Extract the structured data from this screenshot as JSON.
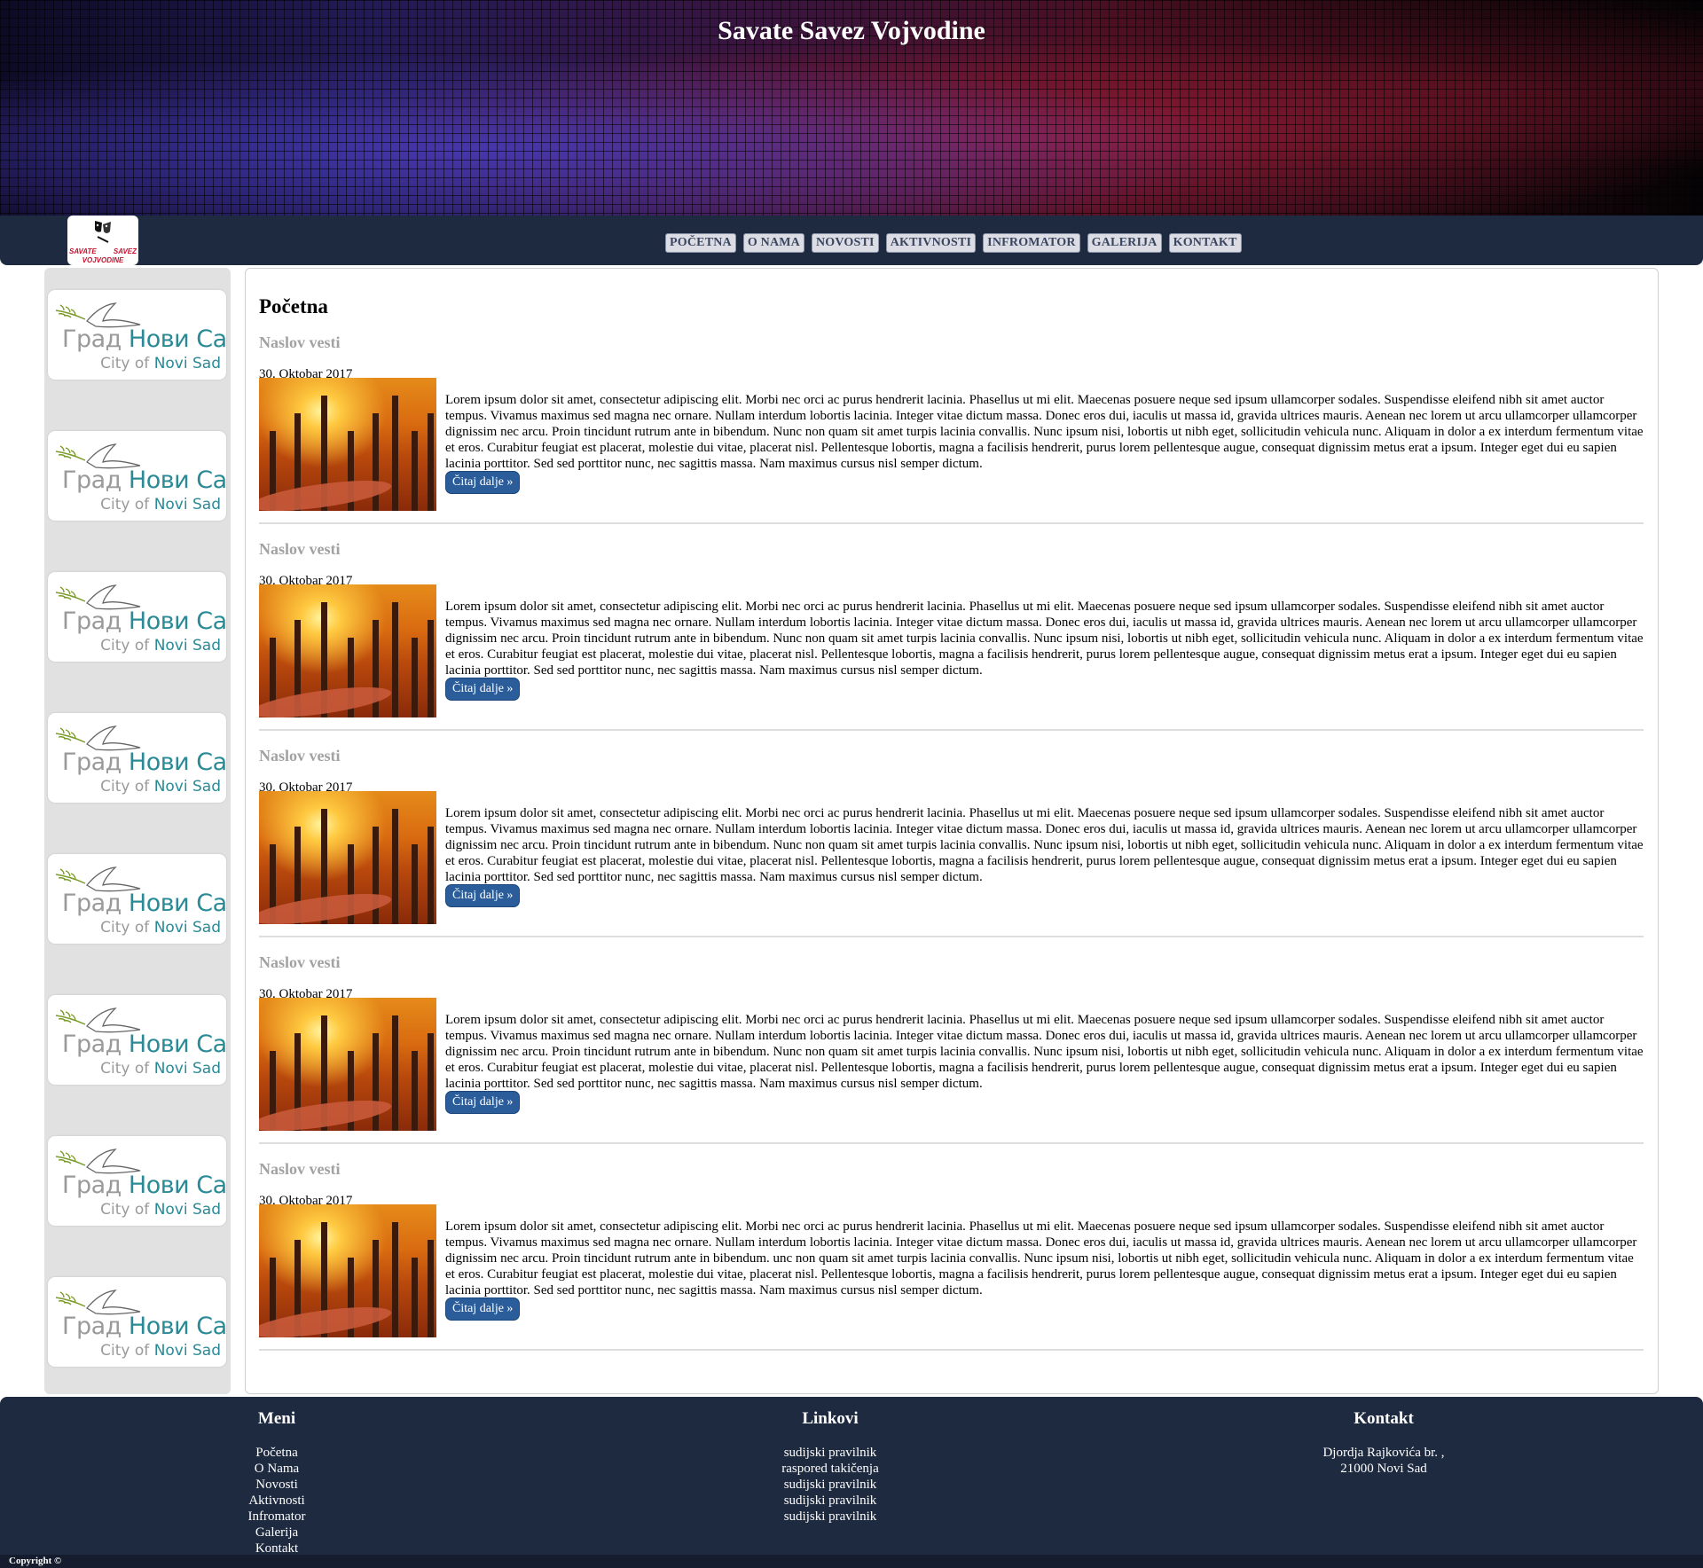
{
  "header": {
    "title": "Savate Savez Vojvodine"
  },
  "logo": {
    "line1": "SAVATE",
    "line2": "SAVEZ",
    "line3": "VOJVODINE"
  },
  "nav": {
    "items": [
      {
        "label": "POČETNA"
      },
      {
        "label": "O NAMA"
      },
      {
        "label": "NOVOSTI"
      },
      {
        "label": "AKTIVNOSTI"
      },
      {
        "label": "INFROMATOR"
      },
      {
        "label": "GALERIJA"
      },
      {
        "label": "KONTAKT"
      }
    ]
  },
  "sidebar": {
    "sponsor": {
      "cyr_prefix": "Град ",
      "cyr_name": "Нови Сад",
      "lat_prefix": "City of ",
      "lat_name": "Novi Sad"
    }
  },
  "main": {
    "heading": "Početna",
    "articles": [
      {
        "title": "Naslov vesti",
        "date": "30. Oktobar 2017",
        "text": "Lorem ipsum dolor sit amet, consectetur adipiscing elit. Morbi nec orci ac purus hendrerit lacinia. Phasellus ut mi elit. Maecenas posuere neque sed ipsum ullamcorper sodales. Suspendisse eleifend nibh sit amet auctor tempus. Vivamus maximus sed magna nec ornare. Nullam interdum lobortis lacinia. Integer vitae dictum massa. Donec eros dui, iaculis ut massa id, gravida ultrices mauris. Aenean nec lorem ut arcu ullamcorper ullamcorper dignissim nec arcu. Proin tincidunt rutrum ante in bibendum. Nunc non quam sit amet turpis lacinia convallis. Nunc ipsum nisi, lobortis ut nibh eget, sollicitudin vehicula nunc. Aliquam in dolor a ex interdum fermentum vitae et eros. Curabitur feugiat est placerat, molestie dui vitae, placerat nisl. Pellentesque lobortis, magna a facilisis hendrerit, purus lorem pellentesque augue, consequat dignissim metus erat a ipsum. Integer eget dui eu sapien lacinia porttitor. Sed sed porttitor nunc, nec sagittis massa. Nam maximus cursus nisl semper dictum.",
        "button": "Čitaj dalje »"
      },
      {
        "title": "Naslov vesti",
        "date": "30. Oktobar 2017",
        "text": "Lorem ipsum dolor sit amet, consectetur adipiscing elit. Morbi nec orci ac purus hendrerit lacinia. Phasellus ut mi elit. Maecenas posuere neque sed ipsum ullamcorper sodales. Suspendisse eleifend nibh sit amet auctor tempus. Vivamus maximus sed magna nec ornare. Nullam interdum lobortis lacinia. Integer vitae dictum massa. Donec eros dui, iaculis ut massa id, gravida ultrices mauris. Aenean nec lorem ut arcu ullamcorper ullamcorper dignissim nec arcu. Proin tincidunt rutrum ante in bibendum. Nunc non quam sit amet turpis lacinia convallis. Nunc ipsum nisi, lobortis ut nibh eget, sollicitudin vehicula nunc. Aliquam in dolor a ex interdum fermentum vitae et eros. Curabitur feugiat est placerat, molestie dui vitae, placerat nisl. Pellentesque lobortis, magna a facilisis hendrerit, purus lorem pellentesque augue, consequat dignissim metus erat a ipsum. Integer eget dui eu sapien lacinia porttitor. Sed sed porttitor nunc, nec sagittis massa. Nam maximus cursus nisl semper dictum.",
        "button": "Čitaj dalje »"
      },
      {
        "title": "Naslov vesti",
        "date": "30. Oktobar 2017",
        "text": "Lorem ipsum dolor sit amet, consectetur adipiscing elit. Morbi nec orci ac purus hendrerit lacinia. Phasellus ut mi elit. Maecenas posuere neque sed ipsum ullamcorper sodales. Suspendisse eleifend nibh sit amet auctor tempus. Vivamus maximus sed magna nec ornare. Nullam interdum lobortis lacinia. Integer vitae dictum massa. Donec eros dui, iaculis ut massa id, gravida ultrices mauris. Aenean nec lorem ut arcu ullamcorper ullamcorper dignissim nec arcu. Proin tincidunt rutrum ante in bibendum. Nunc non quam sit amet turpis lacinia convallis. Nunc ipsum nisi, lobortis ut nibh eget, sollicitudin vehicula nunc. Aliquam in dolor a ex interdum fermentum vitae et eros. Curabitur feugiat est placerat, molestie dui vitae, placerat nisl. Pellentesque lobortis, magna a facilisis hendrerit, purus lorem pellentesque augue, consequat dignissim metus erat a ipsum. Integer eget dui eu sapien lacinia porttitor. Sed sed porttitor nunc, nec sagittis massa. Nam maximus cursus nisl semper dictum.",
        "button": "Čitaj dalje »"
      },
      {
        "title": "Naslov vesti",
        "date": "30. Oktobar 2017",
        "text": "Lorem ipsum dolor sit amet, consectetur adipiscing elit. Morbi nec orci ac purus hendrerit lacinia. Phasellus ut mi elit. Maecenas posuere neque sed ipsum ullamcorper sodales. Suspendisse eleifend nibh sit amet auctor tempus. Vivamus maximus sed magna nec ornare. Nullam interdum lobortis lacinia. Integer vitae dictum massa. Donec eros dui, iaculis ut massa id, gravida ultrices mauris. Aenean nec lorem ut arcu ullamcorper ullamcorper dignissim nec arcu. Proin tincidunt rutrum ante in bibendum. Nunc non quam sit amet turpis lacinia convallis. Nunc ipsum nisi, lobortis ut nibh eget, sollicitudin vehicula nunc. Aliquam in dolor a ex interdum fermentum vitae et eros. Curabitur feugiat est placerat, molestie dui vitae, placerat nisl. Pellentesque lobortis, magna a facilisis hendrerit, purus lorem pellentesque augue, consequat dignissim metus erat a ipsum. Integer eget dui eu sapien lacinia porttitor. Sed sed porttitor nunc, nec sagittis massa. Nam maximus cursus nisl semper dictum.",
        "button": "Čitaj dalje »"
      },
      {
        "title": "Naslov vesti",
        "date": "30. Oktobar 2017",
        "text": "Lorem ipsum dolor sit amet, consectetur adipiscing elit. Morbi nec orci ac purus hendrerit lacinia. Phasellus ut mi elit. Maecenas posuere neque sed ipsum ullamcorper sodales. Suspendisse eleifend nibh sit amet auctor tempus. Vivamus maximus sed magna nec ornare. Nullam interdum lobortis lacinia. Integer vitae dictum massa. Donec eros dui, iaculis ut massa id, gravida ultrices mauris. Aenean nec lorem ut arcu ullamcorper ullamcorper dignissim nec arcu. Proin tincidunt rutrum ante in bibendum. unc non quam sit amet turpis lacinia convallis. Nunc ipsum nisi, lobortis ut nibh eget, sollicitudin vehicula nunc. Aliquam in dolor a ex interdum fermentum vitae et eros. Curabitur feugiat est placerat, molestie dui vitae, placerat nisl. Pellentesque lobortis, magna a facilisis hendrerit, purus lorem pellentesque augue, consequat dignissim metus erat a ipsum. Integer eget dui eu sapien lacinia porttitor. Sed sed porttitor nunc, nec sagittis massa. Nam maximus cursus nisl semper dictum.",
        "button": "Čitaj dalje »"
      }
    ]
  },
  "footer": {
    "meni": {
      "heading": "Meni",
      "items": [
        "Početna",
        "O Nama",
        "Novosti",
        "Aktivnosti",
        "Infromator",
        "Galerija",
        "Kontakt"
      ]
    },
    "linkovi": {
      "heading": "Linkovi",
      "items": [
        "sudijski pravilnik",
        "raspored takičenja",
        "sudijski pravilnik",
        "sudijski pravilnik",
        "sudijski pravilnik"
      ]
    },
    "kontakt": {
      "heading": "Kontakt",
      "line1": "Djordja Rajkovića br. ,",
      "line2": "21000 Novi Sad"
    },
    "copyright": "Copyright ©"
  }
}
